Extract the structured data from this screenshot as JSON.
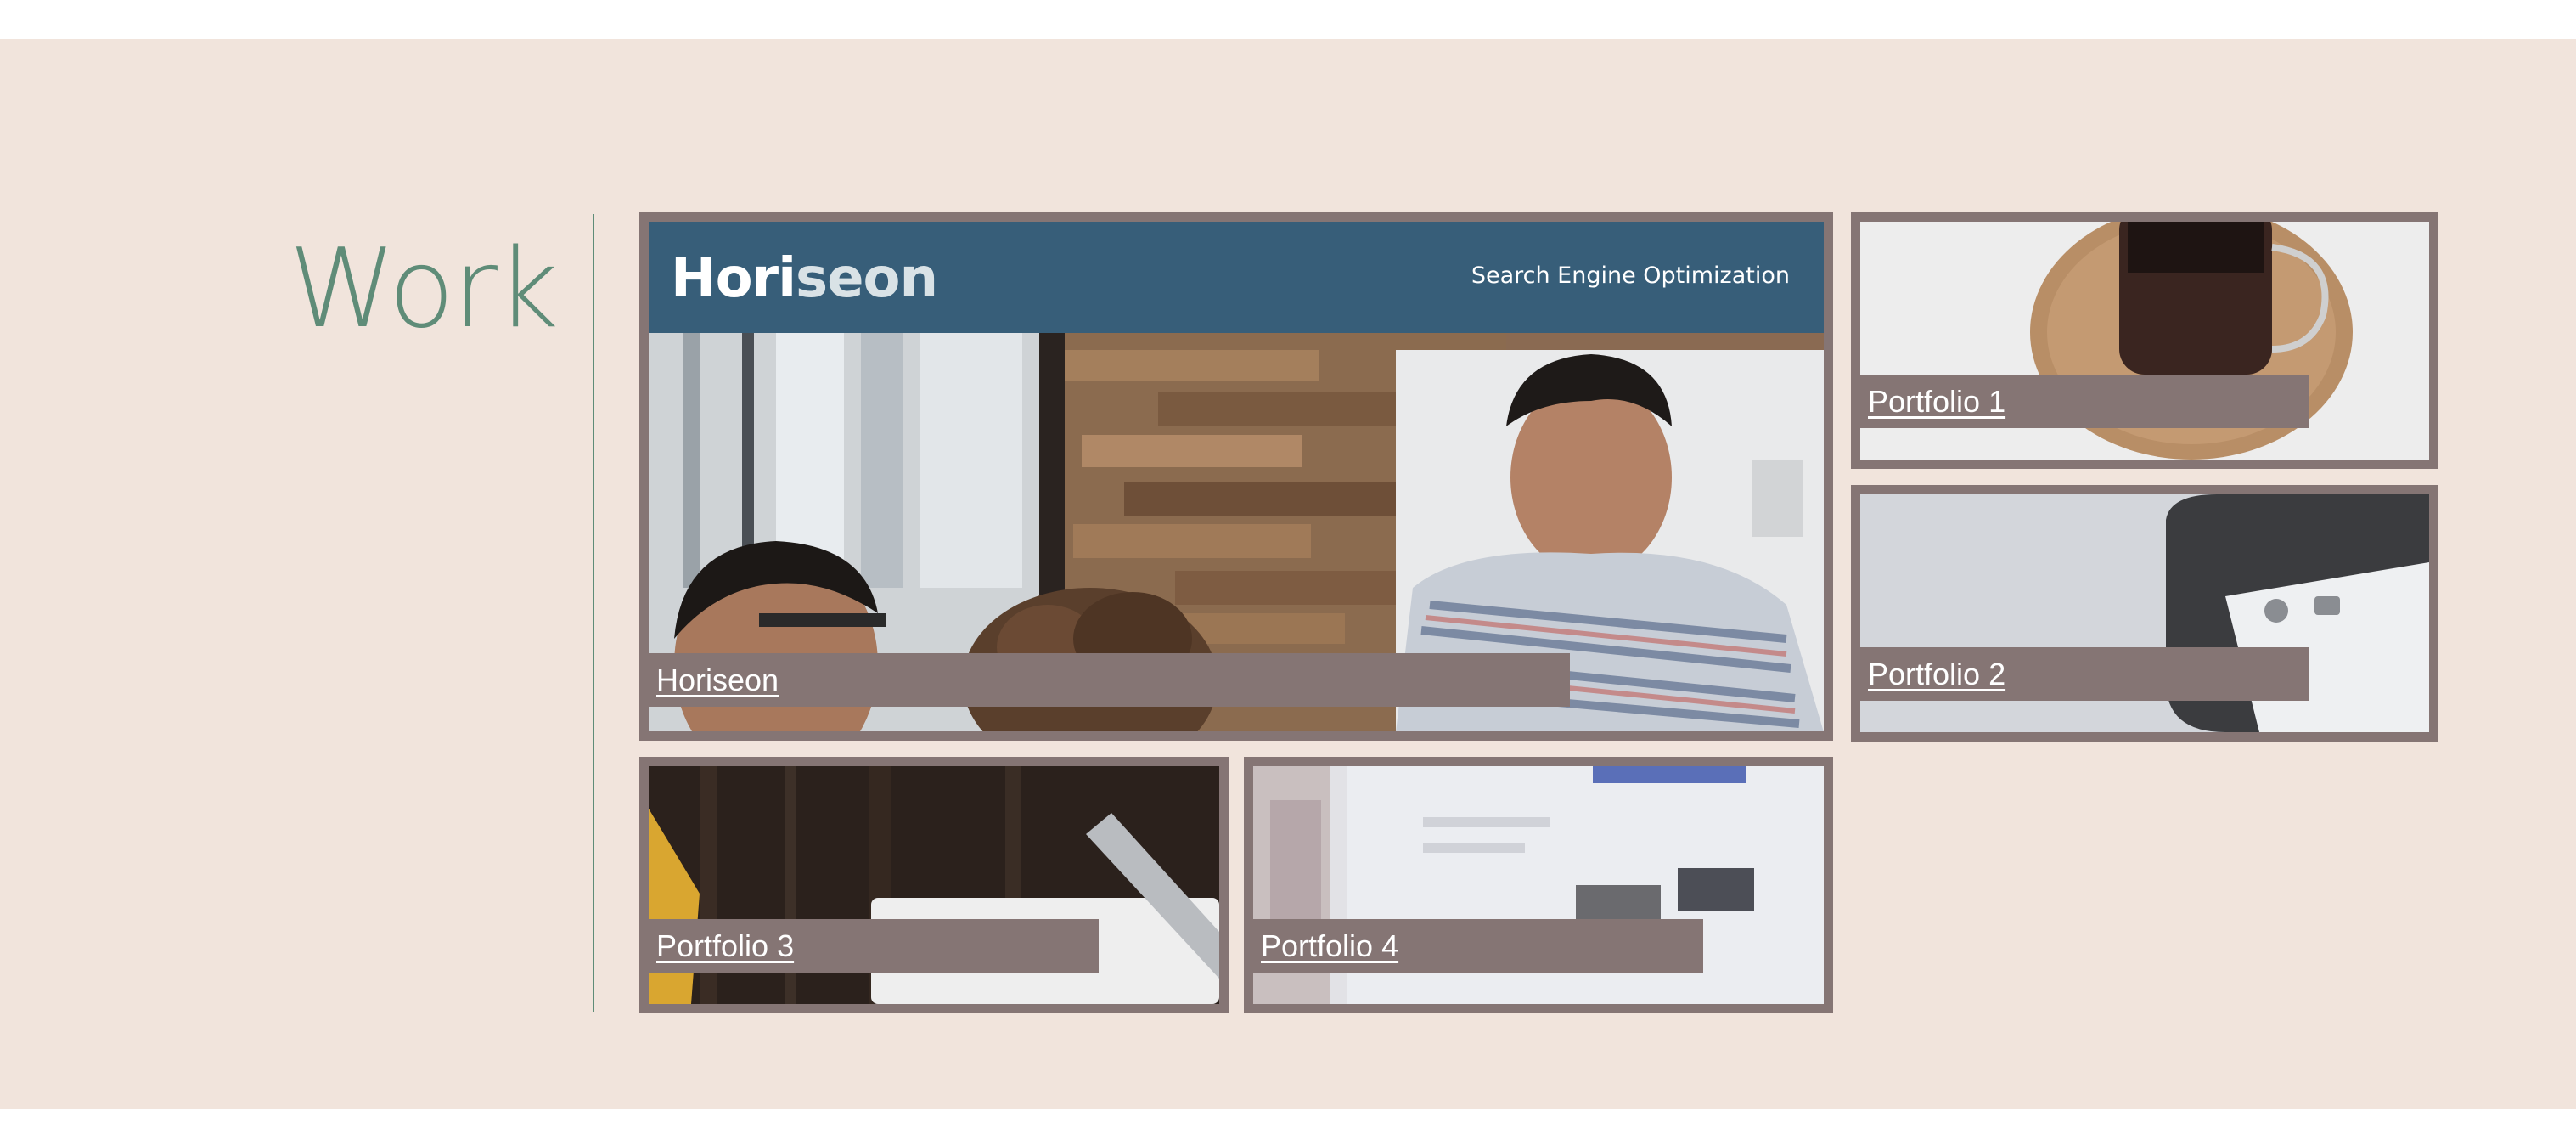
{
  "section": {
    "title": "Work"
  },
  "featured": {
    "brand_main": "Hori",
    "brand_accent": "seon",
    "header_subtitle": "Search Engine Optimization",
    "link_label": "Horiseon"
  },
  "portfolio": [
    {
      "label": "Portfolio 1"
    },
    {
      "label": "Portfolio 2"
    },
    {
      "label": "Portfolio 3"
    },
    {
      "label": "Portfolio 4"
    }
  ],
  "colors": {
    "background": "#f1e4dc",
    "accent_green": "#5f8c78",
    "card_border": "#857574",
    "header_blue": "#375e79"
  }
}
